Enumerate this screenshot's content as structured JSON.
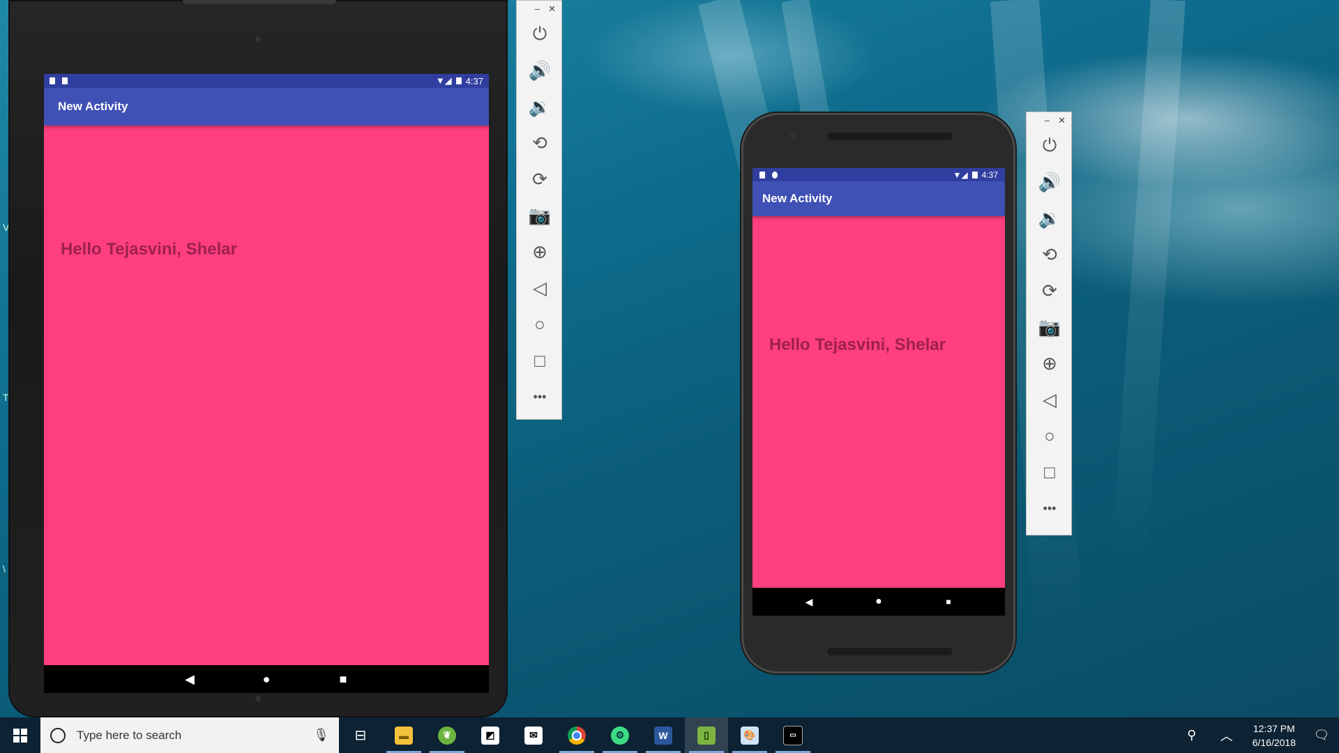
{
  "app": {
    "activity_title": "New Activity",
    "greeting": "Hello Tejasvini, Shelar",
    "status_time": "4:37"
  },
  "colors": {
    "app_bar": "#3f51b5",
    "status_bar": "#303f9f",
    "content_bg": "#ff3f7f",
    "greeting_text": "#9e2050"
  },
  "nav": {
    "back": "◀",
    "home": "●",
    "recents": "■"
  },
  "emulator_toolbar": {
    "minimize": "–",
    "close": "✕",
    "buttons": [
      {
        "icon": "power-icon",
        "glyph": "⏻"
      },
      {
        "icon": "volume-up-icon",
        "glyph": "🔊"
      },
      {
        "icon": "volume-down-icon",
        "glyph": "🔉"
      },
      {
        "icon": "rotate-left-icon",
        "glyph": "⟲"
      },
      {
        "icon": "rotate-right-icon",
        "glyph": "⟳"
      },
      {
        "icon": "camera-icon",
        "glyph": "📷"
      },
      {
        "icon": "zoom-icon",
        "glyph": "⊕"
      },
      {
        "icon": "back-icon",
        "glyph": "◁"
      },
      {
        "icon": "home-icon",
        "glyph": "○"
      },
      {
        "icon": "overview-icon",
        "glyph": "□"
      },
      {
        "icon": "more-icon",
        "glyph": "•••"
      }
    ]
  },
  "taskbar": {
    "search_placeholder": "Type here to search",
    "clock_time": "12:37 PM",
    "clock_date": "6/16/2018",
    "apps": [
      "task-view-icon",
      "file-explorer-icon",
      "spring-tool-icon",
      "sticky-notes-icon",
      "mail-icon",
      "chrome-icon",
      "android-studio-icon",
      "word-icon",
      "emulator-icon",
      "paint-icon",
      "terminal-icon"
    ]
  },
  "desktop_edge_letters": [
    "V",
    "T",
    "\\"
  ]
}
